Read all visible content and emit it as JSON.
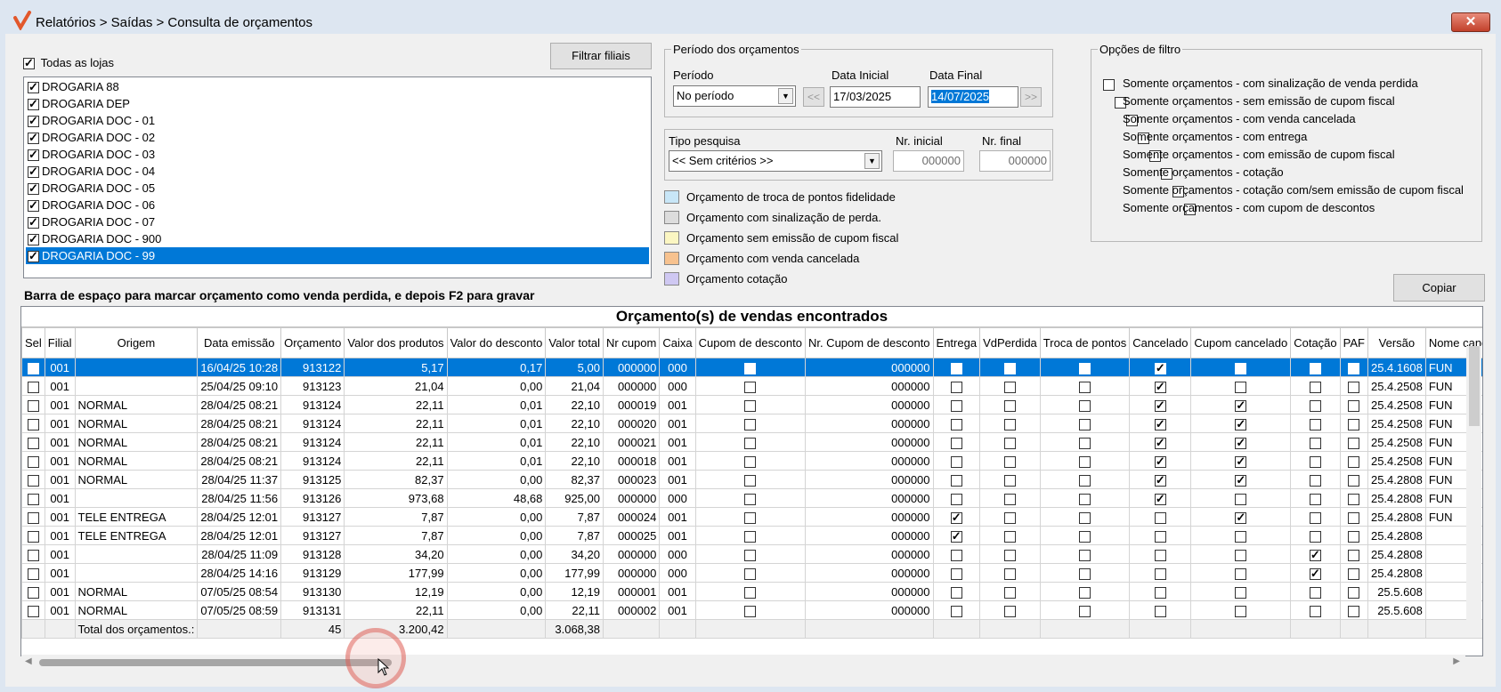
{
  "window": {
    "title": "Relatórios > Saídas > Consulta de orçamentos",
    "close_label": "✕"
  },
  "stores": {
    "all_label": "Todas as lojas",
    "all_checked": true,
    "filter_button": "Filtrar filiais",
    "items": [
      {
        "name": "DROGARIA 88",
        "checked": true
      },
      {
        "name": "DROGARIA DEP",
        "checked": true
      },
      {
        "name": "DROGARIA DOC - 01",
        "checked": true
      },
      {
        "name": "DROGARIA DOC - 02",
        "checked": true
      },
      {
        "name": "DROGARIA DOC - 03",
        "checked": true
      },
      {
        "name": "DROGARIA DOC - 04",
        "checked": true
      },
      {
        "name": "DROGARIA DOC - 05",
        "checked": true
      },
      {
        "name": "DROGARIA DOC - 06",
        "checked": true
      },
      {
        "name": "DROGARIA DOC - 07",
        "checked": true
      },
      {
        "name": "DROGARIA DOC - 900",
        "checked": true
      },
      {
        "name": "DROGARIA DOC - 99",
        "checked": true,
        "selected": true
      }
    ]
  },
  "period": {
    "group_title": "Período dos orçamentos",
    "period_label": "Período",
    "period_value": "No período",
    "start_label": "Data Inicial",
    "start_value": "17/03/2025",
    "end_label": "Data Final",
    "end_value": "14/07/2025",
    "prev_label": "<<",
    "next_label": ">>"
  },
  "search": {
    "type_label": "Tipo pesquisa",
    "type_value": "<< Sem critérios >>",
    "nr_start_label": "Nr. inicial",
    "nr_start_value": "000000",
    "nr_end_label": "Nr. final",
    "nr_end_value": "000000"
  },
  "legend": [
    {
      "label": "Orçamento de troca de pontos fidelidade",
      "color": "#c8e6f7"
    },
    {
      "label": "Orçamento com sinalização de perda.",
      "color": "#dcdcdc"
    },
    {
      "label": "Orçamento sem emissão de cupom fiscal",
      "color": "#fbf6c2"
    },
    {
      "label": "Orçamento com venda cancelada",
      "color": "#f7c28f"
    },
    {
      "label": "Orçamento cotação",
      "color": "#cfc8f2"
    }
  ],
  "filter_options": {
    "group_title": "Opções de filtro",
    "items": [
      "Somente orçamentos - com sinalização de venda perdida",
      "Somente orçamentos - sem emissão de cupom fiscal",
      "Somente orçamentos - com venda cancelada",
      "Somente orçamentos - com entrega",
      "Somente orçamentos - com emissão de cupom fiscal",
      "Somente orçamentos - cotação",
      "Somente orçamentos - cotação com/sem emissão de cupom fiscal",
      "Somente orçamentos - com cupom de descontos"
    ]
  },
  "hint": "Barra de espaço para marcar orçamento como venda perdida, e depois F2 para gravar",
  "copy_button": "Copiar",
  "grid": {
    "title": "Orçamento(s) de vendas encontrados",
    "columns": [
      "Sel",
      "Filial",
      "Origem",
      "Data emissão",
      "Orçamento",
      "Valor dos produtos",
      "Valor do desconto",
      "Valor total",
      "Nr cupom",
      "Caixa",
      "Cupom de desconto",
      "Nr. Cupom de desconto",
      "Entrega",
      "VdPerdida",
      "Troca de pontos",
      "Cancelado",
      "Cupom cancelado",
      "Cotação",
      "PAF",
      "Versão",
      "Nome cancelou"
    ],
    "rows": [
      {
        "filial": "001",
        "origem": "",
        "data": "16/04/25 10:28",
        "orc": "913122",
        "vprod": "5,17",
        "vdesc": "0,17",
        "vtot": "5,00",
        "cupom": "000000",
        "caixa": "000",
        "nrcd": "000000",
        "entrega": false,
        "vdp": false,
        "troca": false,
        "canc": true,
        "cupcanc": false,
        "cot": false,
        "paf": false,
        "versao": "25.4.1608",
        "nome": "FUN",
        "selected": true
      },
      {
        "filial": "001",
        "origem": "",
        "data": "25/04/25 09:10",
        "orc": "913123",
        "vprod": "21,04",
        "vdesc": "0,00",
        "vtot": "21,04",
        "cupom": "000000",
        "caixa": "000",
        "nrcd": "000000",
        "entrega": false,
        "vdp": false,
        "troca": false,
        "canc": true,
        "cupcanc": false,
        "cot": false,
        "paf": false,
        "versao": "25.4.2508",
        "nome": "FUN"
      },
      {
        "filial": "001",
        "origem": "NORMAL",
        "data": "28/04/25 08:21",
        "orc": "913124",
        "vprod": "22,11",
        "vdesc": "0,01",
        "vtot": "22,10",
        "cupom": "000019",
        "caixa": "001",
        "nrcd": "000000",
        "entrega": false,
        "vdp": false,
        "troca": false,
        "canc": true,
        "cupcanc": true,
        "cot": false,
        "paf": false,
        "versao": "25.4.2508",
        "nome": "FUN"
      },
      {
        "filial": "001",
        "origem": "NORMAL",
        "data": "28/04/25 08:21",
        "orc": "913124",
        "vprod": "22,11",
        "vdesc": "0,01",
        "vtot": "22,10",
        "cupom": "000020",
        "caixa": "001",
        "nrcd": "000000",
        "entrega": false,
        "vdp": false,
        "troca": false,
        "canc": true,
        "cupcanc": true,
        "cot": false,
        "paf": false,
        "versao": "25.4.2508",
        "nome": "FUN"
      },
      {
        "filial": "001",
        "origem": "NORMAL",
        "data": "28/04/25 08:21",
        "orc": "913124",
        "vprod": "22,11",
        "vdesc": "0,01",
        "vtot": "22,10",
        "cupom": "000021",
        "caixa": "001",
        "nrcd": "000000",
        "entrega": false,
        "vdp": false,
        "troca": false,
        "canc": true,
        "cupcanc": true,
        "cot": false,
        "paf": false,
        "versao": "25.4.2508",
        "nome": "FUN"
      },
      {
        "filial": "001",
        "origem": "NORMAL",
        "data": "28/04/25 08:21",
        "orc": "913124",
        "vprod": "22,11",
        "vdesc": "0,01",
        "vtot": "22,10",
        "cupom": "000018",
        "caixa": "001",
        "nrcd": "000000",
        "entrega": false,
        "vdp": false,
        "troca": false,
        "canc": true,
        "cupcanc": true,
        "cot": false,
        "paf": false,
        "versao": "25.4.2508",
        "nome": "FUN"
      },
      {
        "filial": "001",
        "origem": "NORMAL",
        "data": "28/04/25 11:37",
        "orc": "913125",
        "vprod": "82,37",
        "vdesc": "0,00",
        "vtot": "82,37",
        "cupom": "000023",
        "caixa": "001",
        "nrcd": "000000",
        "entrega": false,
        "vdp": false,
        "troca": false,
        "canc": true,
        "cupcanc": true,
        "cot": false,
        "paf": false,
        "versao": "25.4.2808",
        "nome": "FUN"
      },
      {
        "filial": "001",
        "origem": "",
        "data": "28/04/25 11:56",
        "orc": "913126",
        "vprod": "973,68",
        "vdesc": "48,68",
        "vtot": "925,00",
        "cupom": "000000",
        "caixa": "000",
        "nrcd": "000000",
        "entrega": false,
        "vdp": false,
        "troca": false,
        "canc": true,
        "cupcanc": false,
        "cot": false,
        "paf": false,
        "versao": "25.4.2808",
        "nome": "FUN"
      },
      {
        "filial": "001",
        "origem": "TELE ENTREGA",
        "data": "28/04/25 12:01",
        "orc": "913127",
        "vprod": "7,87",
        "vdesc": "0,00",
        "vtot": "7,87",
        "cupom": "000024",
        "caixa": "001",
        "nrcd": "000000",
        "entrega": true,
        "vdp": false,
        "troca": false,
        "canc": false,
        "cupcanc": true,
        "cot": false,
        "paf": false,
        "versao": "25.4.2808",
        "nome": "FUN"
      },
      {
        "filial": "001",
        "origem": "TELE ENTREGA",
        "data": "28/04/25 12:01",
        "orc": "913127",
        "vprod": "7,87",
        "vdesc": "0,00",
        "vtot": "7,87",
        "cupom": "000025",
        "caixa": "001",
        "nrcd": "000000",
        "entrega": true,
        "vdp": false,
        "troca": false,
        "canc": false,
        "cupcanc": false,
        "cot": false,
        "paf": false,
        "versao": "25.4.2808",
        "nome": ""
      },
      {
        "filial": "001",
        "origem": "",
        "data": "28/04/25 11:09",
        "orc": "913128",
        "vprod": "34,20",
        "vdesc": "0,00",
        "vtot": "34,20",
        "cupom": "000000",
        "caixa": "000",
        "nrcd": "000000",
        "entrega": false,
        "vdp": false,
        "troca": false,
        "canc": false,
        "cupcanc": false,
        "cot": true,
        "paf": false,
        "versao": "25.4.2808",
        "nome": ""
      },
      {
        "filial": "001",
        "origem": "",
        "data": "28/04/25 14:16",
        "orc": "913129",
        "vprod": "177,99",
        "vdesc": "0,00",
        "vtot": "177,99",
        "cupom": "000000",
        "caixa": "000",
        "nrcd": "000000",
        "entrega": false,
        "vdp": false,
        "troca": false,
        "canc": false,
        "cupcanc": false,
        "cot": true,
        "paf": false,
        "versao": "25.4.2808",
        "nome": ""
      },
      {
        "filial": "001",
        "origem": "NORMAL",
        "data": "07/05/25 08:54",
        "orc": "913130",
        "vprod": "12,19",
        "vdesc": "0,00",
        "vtot": "12,19",
        "cupom": "000001",
        "caixa": "001",
        "nrcd": "000000",
        "entrega": false,
        "vdp": false,
        "troca": false,
        "canc": false,
        "cupcanc": false,
        "cot": false,
        "paf": false,
        "versao": "25.5.608",
        "nome": ""
      },
      {
        "filial": "001",
        "origem": "NORMAL",
        "data": "07/05/25 08:59",
        "orc": "913131",
        "vprod": "22,11",
        "vdesc": "0,00",
        "vtot": "22,11",
        "cupom": "000002",
        "caixa": "001",
        "nrcd": "000000",
        "entrega": false,
        "vdp": false,
        "troca": false,
        "canc": false,
        "cupcanc": false,
        "cot": false,
        "paf": false,
        "versao": "25.5.608",
        "nome": ""
      }
    ],
    "totals": {
      "label": "Total dos orçamentos.:",
      "count": "45",
      "products": "3.200,42",
      "total": "3.068,38"
    }
  },
  "colors": {
    "selection": "#0078d7",
    "title_bg": "#dde6f1",
    "logo": "#e2572b"
  }
}
